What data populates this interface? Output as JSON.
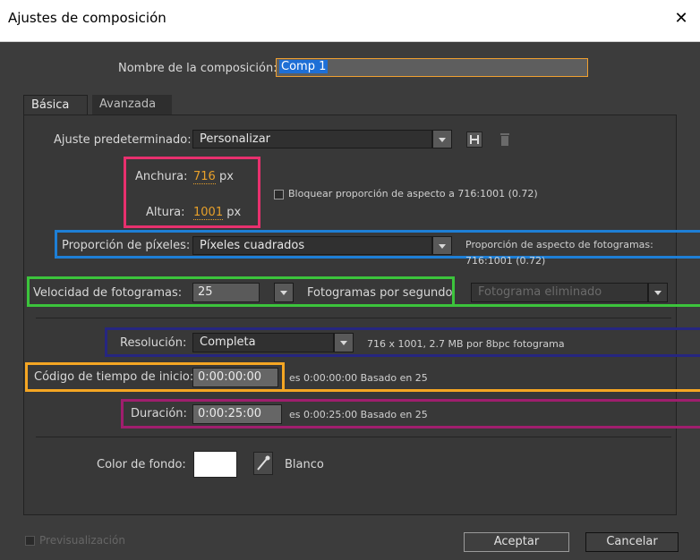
{
  "window": {
    "title": "Ajustes de composición"
  },
  "comp_name": {
    "label": "Nombre de la composición:",
    "value": "Comp 1"
  },
  "tabs": [
    {
      "label": "Básica"
    },
    {
      "label": "Avanzada"
    }
  ],
  "preset": {
    "label": "Ajuste predeterminado:",
    "value": "Personalizar"
  },
  "size": {
    "width_label": "Anchura:",
    "width_value": "716",
    "width_unit": "px",
    "height_label": "Altura:",
    "height_value": "1001",
    "height_unit": "px",
    "lock_label": "Bloquear proporción de aspecto a 716:1001 (0.72)"
  },
  "pixel_aspect": {
    "label": "Proporción de píxeles:",
    "value": "Píxeles cuadrados",
    "frame_aspect_label": "Proporción de aspecto de fotogramas:",
    "frame_aspect_value": "716:1001 (0.72)"
  },
  "frame_rate": {
    "label": "Velocidad de fotogramas:",
    "value": "25",
    "unit": "Fotogramas por segundo",
    "drop_frame": "Fotograma eliminado"
  },
  "resolution": {
    "label": "Resolución:",
    "value": "Completa",
    "info": "716 x 1001, 2.7 MB por 8bpc fotograma"
  },
  "start_timecode": {
    "label": "Código de tiempo de inicio:",
    "value": "0:00:00:00",
    "info": "es 0:00:00:00  Basado en 25"
  },
  "duration": {
    "label": "Duración:",
    "value": "0:00:25:00",
    "info": "es 0:00:25:00  Basado en 25"
  },
  "background": {
    "label": "Color de fondo:",
    "color_name": "Blanco",
    "color_hex": "#ffffff"
  },
  "footer": {
    "preview_label": "Previsualización",
    "ok_label": "Aceptar",
    "cancel_label": "Cancelar"
  },
  "highlight_colors": {
    "size": "#e8306e",
    "pixel_aspect": "#1e7fd6",
    "frame_rate": "#3cc43c",
    "resolution": "#262680",
    "start_timecode": "#f5a623",
    "duration": "#a01e6e"
  }
}
